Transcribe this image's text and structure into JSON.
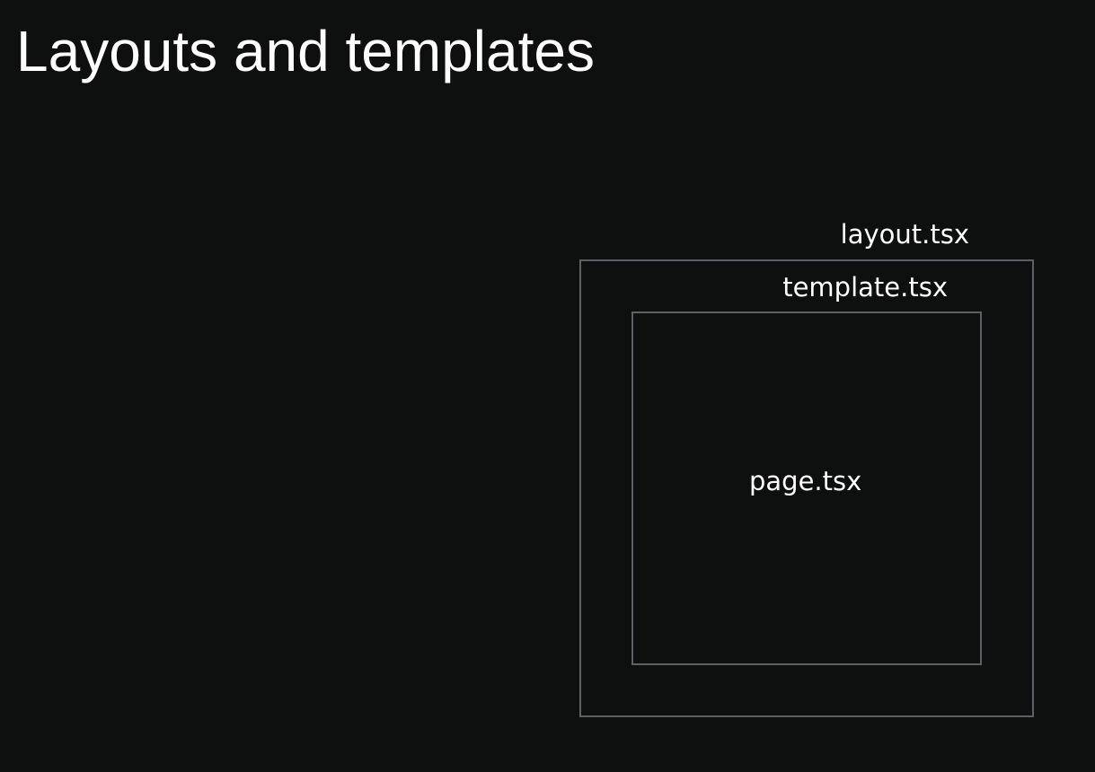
{
  "slide": {
    "title": "Layouts and templates"
  },
  "diagram": {
    "outer": {
      "label": "layout.tsx"
    },
    "middle": {
      "label": "template.tsx"
    },
    "inner": {
      "label": "page.tsx"
    },
    "colors": {
      "background": "#0e0f0f",
      "box_border": "#5a6066",
      "text": "#ffffff"
    }
  }
}
